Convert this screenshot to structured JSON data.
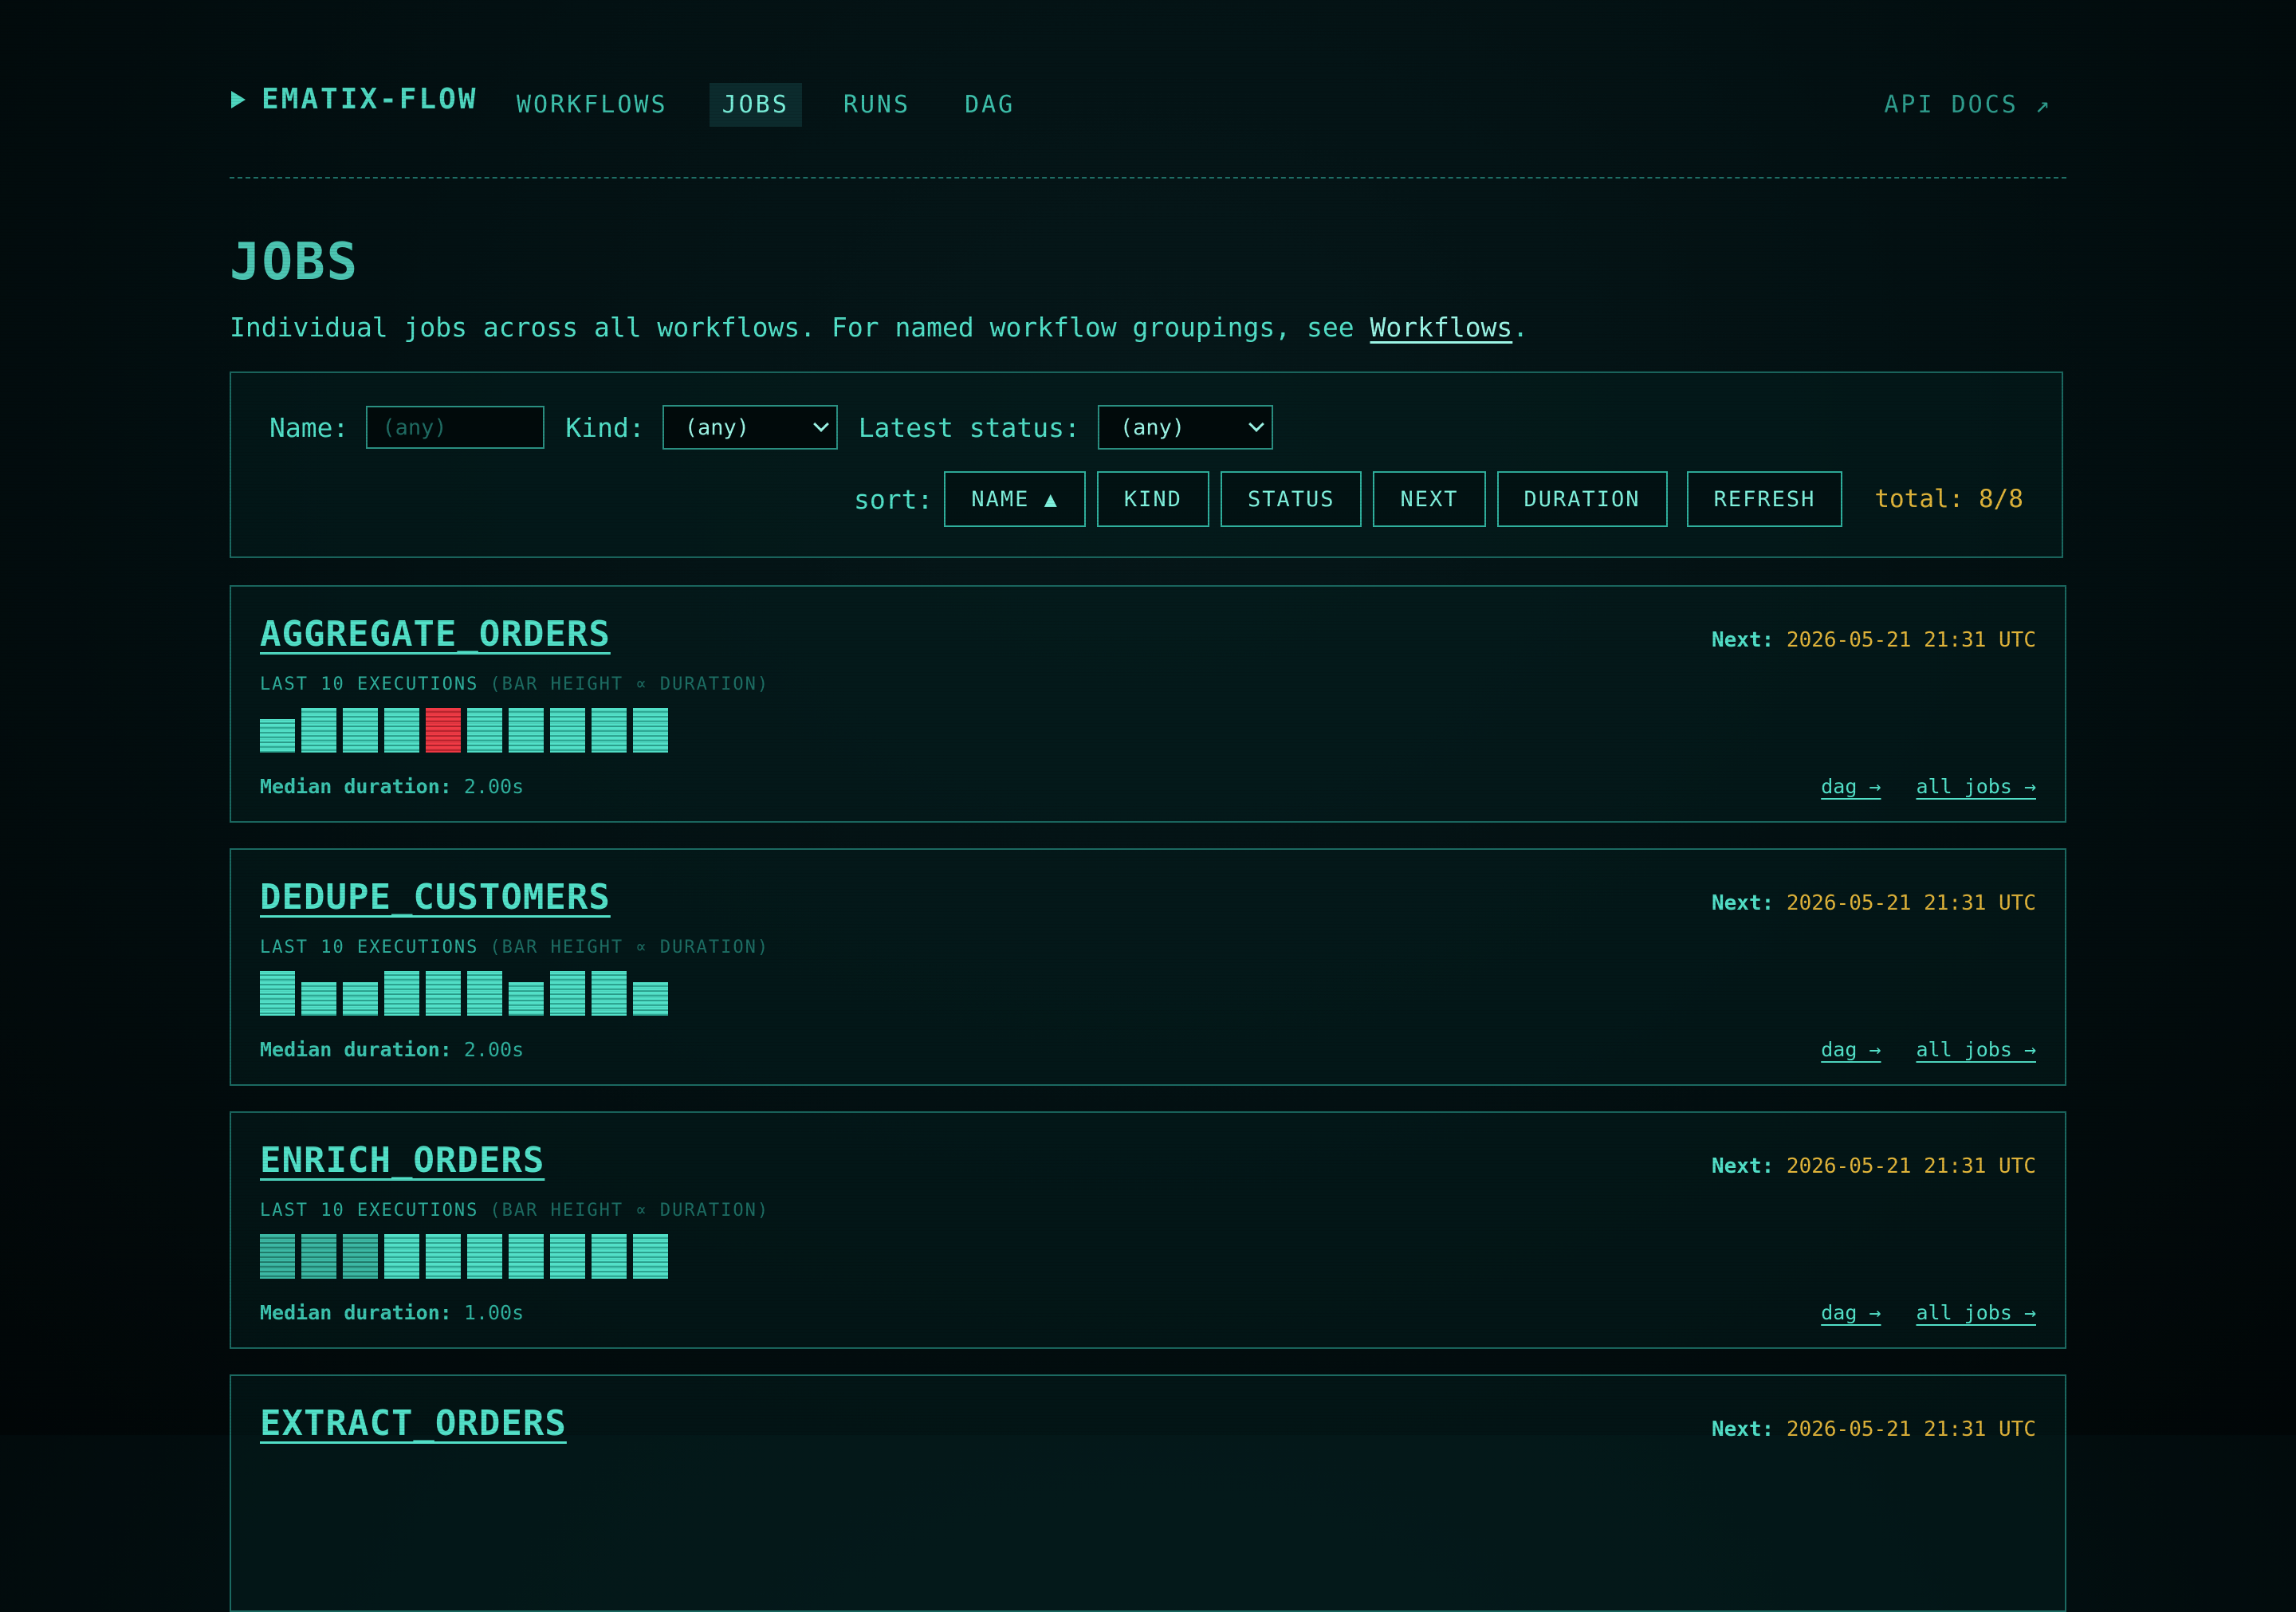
{
  "nav": {
    "brand": "EMATIX-FLOW",
    "links": [
      "WORKFLOWS",
      "JOBS",
      "RUNS",
      "DAG"
    ],
    "active": "JOBS",
    "api_docs": "API DOCS ↗"
  },
  "page": {
    "title": "JOBS",
    "intro_text": "Individual jobs across all workflows. For named workflow groupings, see ",
    "intro_link": "Workflows",
    "intro_end": "."
  },
  "filters": {
    "name_label": "Name:",
    "name_placeholder": "(any)",
    "kind_label": "Kind:",
    "kind_value": "(any)",
    "status_label": "Latest status:",
    "status_value": "(any)",
    "sort_label": "sort:",
    "sort_buttons": [
      "NAME ▲",
      "KIND",
      "STATUS",
      "NEXT",
      "DURATION"
    ],
    "refresh_label": "REFRESH",
    "total": "total: 8/8"
  },
  "jobs": [
    {
      "name": "AGGREGATE_ORDERS",
      "next_label": "Next:",
      "next_value": "2026-05-21 21:31 UTC",
      "exec_label": "LAST 10 EXECUTIONS",
      "exec_note": "(BAR HEIGHT ∝ DURATION)",
      "bars": [
        {
          "level": 0.75,
          "status": "ok"
        },
        {
          "level": 1,
          "status": "ok"
        },
        {
          "level": 1,
          "status": "ok"
        },
        {
          "level": 1,
          "status": "ok"
        },
        {
          "level": 1,
          "status": "fail"
        },
        {
          "level": 1,
          "status": "ok"
        },
        {
          "level": 1,
          "status": "ok"
        },
        {
          "level": 1,
          "status": "ok"
        },
        {
          "level": 1,
          "status": "ok"
        },
        {
          "level": 1,
          "status": "ok"
        }
      ],
      "median_label": "Median duration:",
      "median_value": "2.00s",
      "dag_link": "dag →",
      "all_link": "all jobs →"
    },
    {
      "name": "DEDUPE_CUSTOMERS",
      "next_label": "Next:",
      "next_value": "2026-05-21 21:31 UTC",
      "exec_label": "LAST 10 EXECUTIONS",
      "exec_note": "(BAR HEIGHT ∝ DURATION)",
      "bars": [
        {
          "level": 1,
          "status": "ok"
        },
        {
          "level": 0.75,
          "status": "ok"
        },
        {
          "level": 0.75,
          "status": "ok"
        },
        {
          "level": 1,
          "status": "ok"
        },
        {
          "level": 1,
          "status": "ok"
        },
        {
          "level": 1,
          "status": "ok"
        },
        {
          "level": 0.75,
          "status": "ok"
        },
        {
          "level": 1,
          "status": "ok"
        },
        {
          "level": 1,
          "status": "ok"
        },
        {
          "level": 0.75,
          "status": "ok"
        }
      ],
      "median_label": "Median duration:",
      "median_value": "2.00s",
      "dag_link": "dag →",
      "all_link": "all jobs →"
    },
    {
      "name": "ENRICH_ORDERS",
      "next_label": "Next:",
      "next_value": "2026-05-21 21:31 UTC",
      "exec_label": "LAST 10 EXECUTIONS",
      "exec_note": "(BAR HEIGHT ∝ DURATION)",
      "bars": [
        {
          "level": 1,
          "status": "dim"
        },
        {
          "level": 1,
          "status": "dim"
        },
        {
          "level": 1,
          "status": "dim"
        },
        {
          "level": 1,
          "status": "ok"
        },
        {
          "level": 1,
          "status": "ok"
        },
        {
          "level": 1,
          "status": "ok"
        },
        {
          "level": 1,
          "status": "ok"
        },
        {
          "level": 1,
          "status": "ok"
        },
        {
          "level": 1,
          "status": "ok"
        },
        {
          "level": 1,
          "status": "ok"
        }
      ],
      "median_label": "Median duration:",
      "median_value": "1.00s",
      "dag_link": "dag →",
      "all_link": "all jobs →"
    },
    {
      "name": "EXTRACT_ORDERS",
      "next_label": "Next:",
      "next_value": "2026-05-21 21:31 UTC"
    }
  ]
}
